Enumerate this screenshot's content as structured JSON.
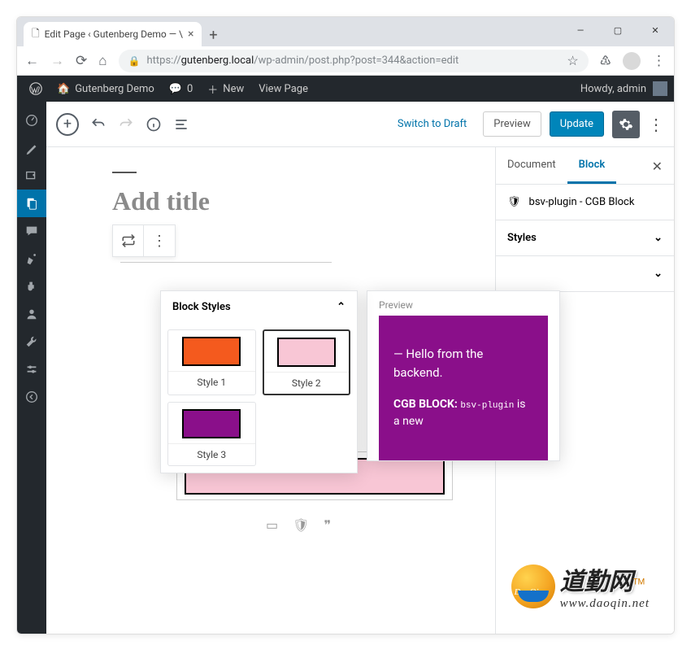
{
  "window": {
    "min": "—",
    "max": "▢",
    "close": "✕"
  },
  "browser": {
    "tab_title": "Edit Page ‹ Gutenberg Demo — \\",
    "url_scheme": "https://",
    "url_host": "gutenberg.local",
    "url_path": "/wp-admin/post.php?post=344&action=edit"
  },
  "adminbar": {
    "site": "Gutenberg Demo",
    "comments": "0",
    "new": "New",
    "view": "View Page",
    "howdy": "Howdy, admin"
  },
  "topbar": {
    "switch_draft": "Switch to Draft",
    "preview": "Preview",
    "update": "Update"
  },
  "canvas": {
    "title_placeholder": "Add title"
  },
  "styles_popover": {
    "header": "Block Styles",
    "items": [
      {
        "label": "Style 1",
        "swatch": "sw-orange",
        "selected": false
      },
      {
        "label": "Style 2",
        "swatch": "sw-pink",
        "selected": true
      },
      {
        "label": "Style 3",
        "swatch": "sw-purple",
        "selected": false
      }
    ]
  },
  "preview": {
    "label": "Preview",
    "line1": "— Hello from the backend.",
    "cgb_label": "CGB BLOCK:",
    "cgb_code": "bsv-plugin",
    "cgb_tail": "is a new"
  },
  "inspector": {
    "tab_document": "Document",
    "tab_block": "Block",
    "block_name": "bsv-plugin - CGB Block",
    "panel_styles": "Styles"
  },
  "watermark": {
    "cn": "道勤网",
    "url": "www.daoqin.net",
    "brand": "DaoQin"
  }
}
